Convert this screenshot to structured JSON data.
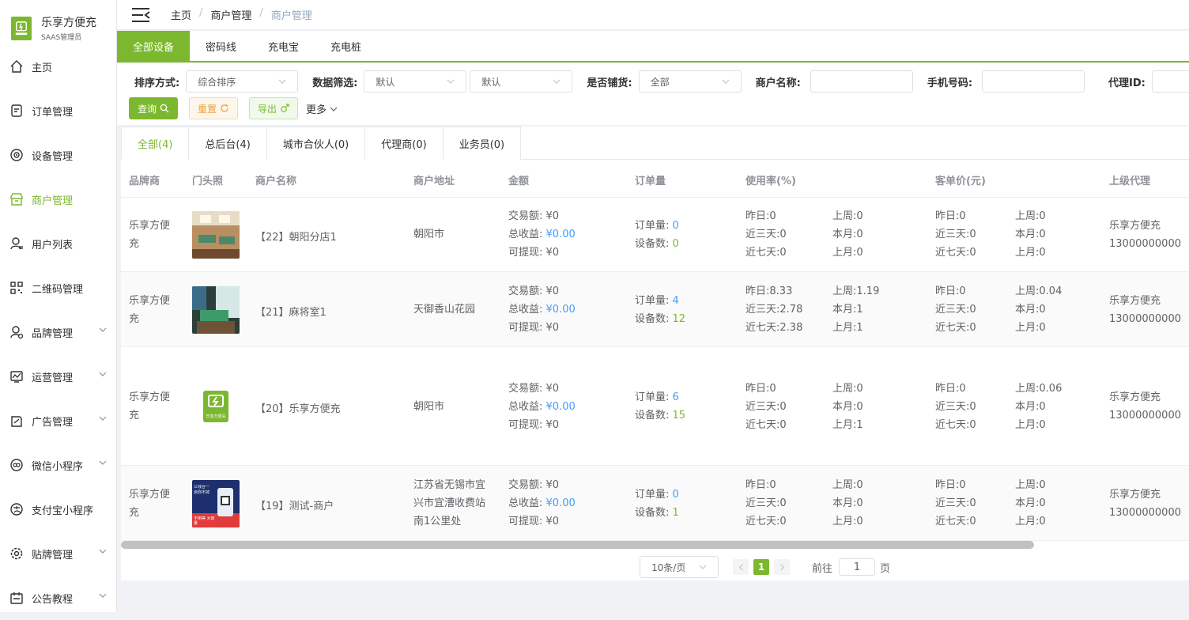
{
  "logo": {
    "title": "乐享方便充",
    "subtitle": "SAAS管理员"
  },
  "sidebar": {
    "items": [
      {
        "label": "主页"
      },
      {
        "label": "订单管理"
      },
      {
        "label": "设备管理"
      },
      {
        "label": "商户管理"
      },
      {
        "label": "用户列表"
      },
      {
        "label": "二维码管理"
      },
      {
        "label": "品牌管理"
      },
      {
        "label": "运营管理"
      },
      {
        "label": "广告管理"
      },
      {
        "label": "微信小程序"
      },
      {
        "label": "支付宝小程序"
      },
      {
        "label": "贴牌管理"
      },
      {
        "label": "公告教程"
      }
    ]
  },
  "breadcrumb": {
    "home": "主页",
    "section": "商户管理",
    "current": "商户管理"
  },
  "topTabs": [
    "全部设备",
    "密码线",
    "充电宝",
    "充电桩"
  ],
  "filter": {
    "sortLabel": "排序方式:",
    "sortValue": "综合排序",
    "dataLabel": "数据筛选:",
    "data1": "默认",
    "data2": "默认",
    "stockLabel": "是否铺货:",
    "stockValue": "全部",
    "nameLabel": "商户名称:",
    "phoneLabel": "手机号码:",
    "agentLabel": "代理ID:",
    "queryBtn": "查询",
    "resetBtn": "重置",
    "exportBtn": "导出",
    "more": "更多"
  },
  "subTabs": [
    "全部(4)",
    "总后台(4)",
    "城市合伙人(0)",
    "代理商(0)",
    "业务员(0)"
  ],
  "columns": [
    "品牌商",
    "门头照",
    "商户名称",
    "商户地址",
    "金额",
    "订单量",
    "使用率(%)",
    "客单价(元)",
    "上级代理"
  ],
  "labels": {
    "trade": "交易额:",
    "income": "总收益:",
    "withdraw": "可提现:",
    "orders": "订单量:",
    "devices": "设备数:",
    "yday": "昨日:",
    "d3": "近三天:",
    "d7": "近七天:",
    "lweek": "上周:",
    "tmonth": "本月:",
    "lmonth": "上月:"
  },
  "rows": [
    {
      "brand1": "乐享方便",
      "brand2": "充",
      "name": "【22】朝阳分店1",
      "address": [
        "朝阳市"
      ],
      "trade": "¥0",
      "income": "¥0.00",
      "withdraw": "¥0",
      "orders": "0",
      "devices": "0",
      "use": {
        "yday": "0",
        "d3": "0",
        "d7": "0",
        "lweek": "0",
        "tmonth": "0",
        "lmonth": "0"
      },
      "avg": {
        "yday": "0",
        "d3": "0",
        "d7": "0",
        "lweek": "0",
        "tmonth": "0",
        "lmonth": "0"
      },
      "agent": "乐享方便充",
      "phone": "13000000000"
    },
    {
      "brand1": "乐享方便",
      "brand2": "充",
      "name": "【21】麻将室1",
      "address": [
        "天御香山花园"
      ],
      "trade": "¥0",
      "income": "¥0.00",
      "withdraw": "¥0",
      "orders": "4",
      "devices": "12",
      "use": {
        "yday": "8.33",
        "d3": "2.78",
        "d7": "2.38",
        "lweek": "1.19",
        "tmonth": "1",
        "lmonth": "1"
      },
      "avg": {
        "yday": "0",
        "d3": "0",
        "d7": "0",
        "lweek": "0.04",
        "tmonth": "0",
        "lmonth": "0"
      },
      "agent": "乐享方便充",
      "phone": "13000000000"
    },
    {
      "brand1": "乐享方便",
      "brand2": "充",
      "name": "【20】乐享方便充",
      "address": [
        "朝阳市"
      ],
      "trade": "¥0",
      "income": "¥0.00",
      "withdraw": "¥0",
      "orders": "6",
      "devices": "15",
      "use": {
        "yday": "0",
        "d3": "0",
        "d7": "0",
        "lweek": "0",
        "tmonth": "0",
        "lmonth": "1"
      },
      "avg": {
        "yday": "0",
        "d3": "0",
        "d7": "0",
        "lweek": "0.06",
        "tmonth": "0",
        "lmonth": "0"
      },
      "agent": "乐享方便充",
      "phone": "13000000000"
    },
    {
      "brand1": "乐享方便",
      "brand2": "充",
      "name": "【19】测试-商户",
      "address": [
        "江苏省无锡市宜",
        "兴市宜漕收费站",
        "南1公里处"
      ],
      "trade": "¥0",
      "income": "¥0.00",
      "withdraw": "¥0",
      "orders": "0",
      "devices": "1",
      "use": {
        "yday": "0",
        "d3": "0",
        "d7": "0",
        "lweek": "0",
        "tmonth": "0",
        "lmonth": "0"
      },
      "avg": {
        "yday": "0",
        "d3": "0",
        "d7": "0",
        "lweek": "0",
        "tmonth": "0",
        "lmonth": "0"
      },
      "agent": "乐享方便充",
      "phone": "13000000000"
    }
  ],
  "pagination": {
    "pageSize": "10条/页",
    "current": "1",
    "goto": "前往",
    "gotoValue": "1",
    "pageUnit": "页"
  },
  "thumbText": {
    "logoCaption": "乐享方便充",
    "adLine1": "三线合一",
    "adLine2": "派你不掉",
    "adSide": "不用等 大数量"
  },
  "colors": {
    "accent": "#7cb82f",
    "link": "#409eff"
  }
}
